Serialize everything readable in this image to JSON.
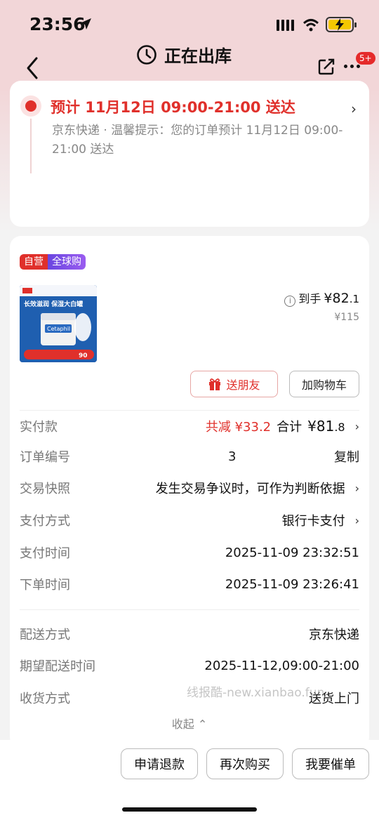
{
  "status_bar": {
    "time": "23:56"
  },
  "nav": {
    "title": "正在出库",
    "badge": "5+"
  },
  "delivery": {
    "eta": "预计 11月12日 09:00-21:00 送达",
    "note": "京东快递 · 温馨提示：您的订单预计 11月12日 09:00-21:00 送达"
  },
  "order": {
    "tag_self": "自营",
    "tag_global": "全球购",
    "product_image_text": {
      "headline": "长效滋润 保湿大白罐",
      "brand": "Cetaphil",
      "promo": "90"
    },
    "price_label": "到手",
    "price_final_main": "¥82",
    "price_final_dec": ".1",
    "price_original": "¥115",
    "btn_gift": "送朋友",
    "btn_cart": "加购物车",
    "rows": {
      "paid_label": "实付款",
      "paid_discount": "共减 ¥33.2",
      "paid_total_label": "合计",
      "paid_total_main": "¥81",
      "paid_total_dec": ".8",
      "order_no_label": "订单编号",
      "order_no_value": "3",
      "order_no_copy": "复制",
      "snapshot_label": "交易快照",
      "snapshot_value": "发生交易争议时，可作为判断依据",
      "pay_method_label": "支付方式",
      "pay_method_value": "银行卡支付",
      "pay_time_label": "支付时间",
      "pay_time_value": "2025-11-09 23:32:51",
      "order_time_label": "下单时间",
      "order_time_value": "2025-11-09 23:26:41",
      "ship_method_label": "配送方式",
      "ship_method_value": "京东快递",
      "expect_time_label": "期望配送时间",
      "expect_time_value": "2025-11-12,09:00-21:00",
      "receive_label": "收货方式",
      "receive_value": "送货上门"
    },
    "collapse": "收起 ⌃",
    "watermark": "线报酷-new.xianbao.fun"
  },
  "bottom": {
    "refund": "申请退款",
    "rebuy": "再次购买",
    "urge": "我要催单"
  }
}
